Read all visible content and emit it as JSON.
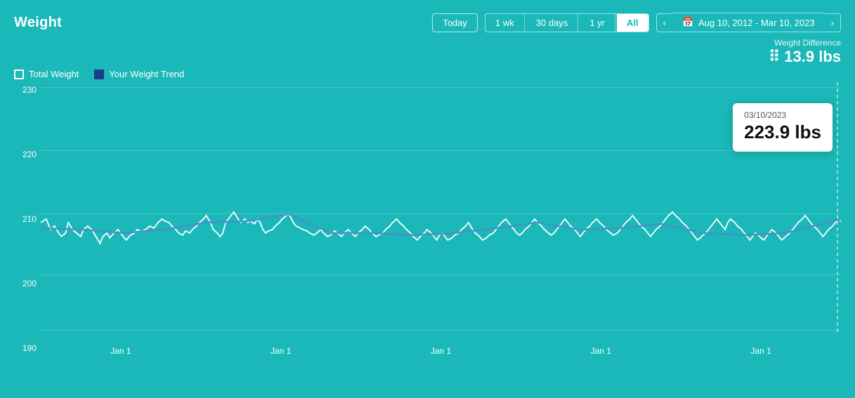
{
  "header": {
    "title": "Weight",
    "filters": [
      "Today",
      "1 wk",
      "30 days",
      "1 yr",
      "All"
    ],
    "active_filter": "All",
    "date_range": "Aug 10, 2012 - Mar 10, 2023",
    "nav_prev": "‹",
    "nav_next": "›"
  },
  "weight_diff": {
    "label": "Weight Difference",
    "icon": "⠿",
    "value": "13.9 lbs"
  },
  "legend": {
    "total_weight": "Total Weight",
    "trend_label": "Your Weight Trend"
  },
  "tooltip": {
    "date": "03/10/2023",
    "value": "223.9 lbs"
  },
  "y_axis": {
    "labels": [
      "230",
      "220",
      "210",
      "200",
      "190"
    ]
  },
  "x_axis": {
    "labels": [
      "Jan 1",
      "Jan 1",
      "Jan 1",
      "Jan 1",
      "Jan 1"
    ]
  },
  "chart": {
    "bg_color": "#1ab8b8"
  }
}
